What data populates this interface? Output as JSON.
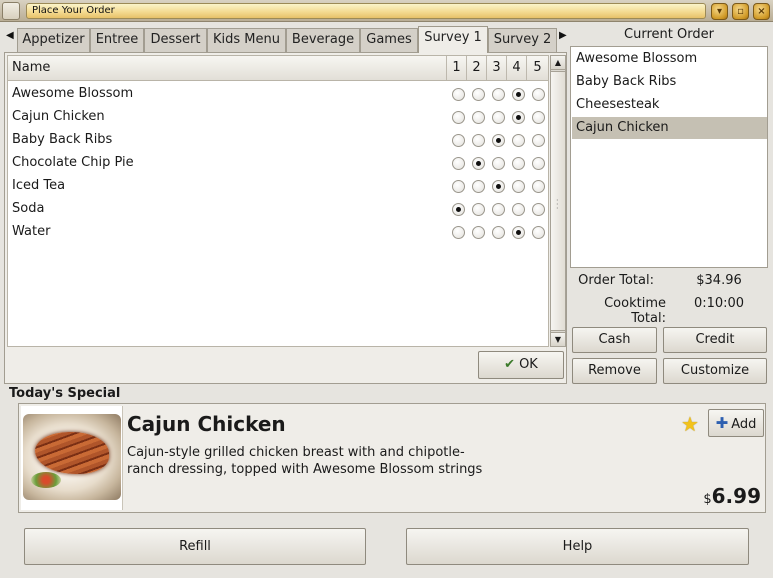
{
  "window": {
    "title": "Place Your Order"
  },
  "tabs": [
    "Appetizer",
    "Entree",
    "Dessert",
    "Kids Menu",
    "Beverage",
    "Games",
    "Survey 1",
    "Survey 2"
  ],
  "active_tab": "Survey 1",
  "survey": {
    "columns": [
      "Name",
      "1",
      "2",
      "3",
      "4",
      "5"
    ],
    "rows": [
      {
        "name": "Awesome Blossom",
        "rating": 4
      },
      {
        "name": "Cajun Chicken",
        "rating": 4
      },
      {
        "name": "Baby Back Ribs",
        "rating": 3
      },
      {
        "name": "Chocolate Chip Pie",
        "rating": 2
      },
      {
        "name": "Iced Tea",
        "rating": 3
      },
      {
        "name": "Soda",
        "rating": 1
      },
      {
        "name": "Water",
        "rating": 4
      }
    ],
    "ok_label": "OK"
  },
  "order": {
    "title": "Current Order",
    "items": [
      "Awesome Blossom",
      "Baby Back Ribs",
      "Cheesesteak",
      "Cajun Chicken"
    ],
    "selected_item": "Cajun Chicken",
    "order_total_label": "Order Total:",
    "order_total": "$34.96",
    "cooktime_label": "Cooktime Total:",
    "cooktime": "0:10:00",
    "buttons": {
      "cash": "Cash",
      "credit": "Credit",
      "remove": "Remove",
      "customize": "Customize"
    }
  },
  "special": {
    "section_title": "Today's Special",
    "name": "Cajun Chicken",
    "description": "Cajun-style grilled chicken breast with and chipotle-ranch dressing, topped with Awesome Blossom strings",
    "add_label": "Add",
    "currency": "$",
    "price": "6.99"
  },
  "footer": {
    "refill": "Refill",
    "help": "Help"
  },
  "icons": {
    "star": "favorite-star-icon",
    "ok": "ok-check-icon",
    "add": "add-plus-icon"
  }
}
